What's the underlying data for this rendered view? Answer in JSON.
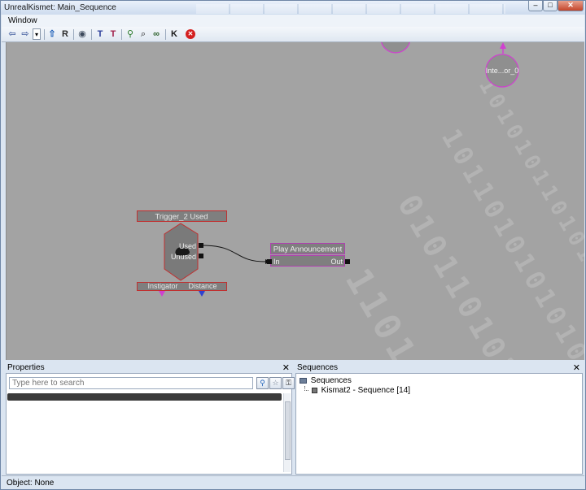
{
  "window": {
    "title": "UnrealKismet: Main_Sequence"
  },
  "menu": {
    "items": [
      "Window"
    ]
  },
  "toolbar": {
    "buttons": [
      {
        "name": "back-icon",
        "glyph": "⇦"
      },
      {
        "name": "forward-icon",
        "glyph": "⇨"
      },
      {
        "name": "history-dropdown-icon",
        "glyph": "▾"
      },
      {
        "name": "parent-sequence-icon",
        "glyph": "⇧"
      },
      {
        "name": "rename-icon",
        "glyph": "R"
      },
      {
        "name": "view-icon",
        "glyph": "◉"
      },
      {
        "name": "hide-unused-icon",
        "glyph": "T"
      },
      {
        "name": "show-connectors-icon",
        "glyph": "T"
      },
      {
        "name": "search-icon",
        "glyph": "⚲"
      },
      {
        "name": "zoom-icon",
        "glyph": "⌕"
      },
      {
        "name": "link-icon",
        "glyph": "∞"
      },
      {
        "name": "kismet-icon",
        "glyph": "K"
      },
      {
        "name": "stop-icon",
        "glyph": "✕"
      }
    ]
  },
  "graph": {
    "event_node": {
      "title": "Trigger_2 Used",
      "outputs": [
        "Used",
        "Unused"
      ],
      "variables": [
        "Instigator",
        "Distance"
      ]
    },
    "action_node": {
      "title": "Play Announcement",
      "input": "In",
      "output": "Out"
    },
    "variable_node_right": {
      "label": "Inte...or_0"
    }
  },
  "properties": {
    "title": "Properties",
    "search_placeholder": "Type here to search"
  },
  "sequences": {
    "title": "Sequences",
    "root": "Sequences",
    "child": "Kismat2 - Sequence [14]"
  },
  "status": {
    "text": "Object: None"
  },
  "colors": {
    "canvas": "#a3a3a3",
    "event_border": "#c03030",
    "action_border": "#b040b0",
    "variable_pink": "#d040d0",
    "variable_blue": "#3040d0"
  }
}
